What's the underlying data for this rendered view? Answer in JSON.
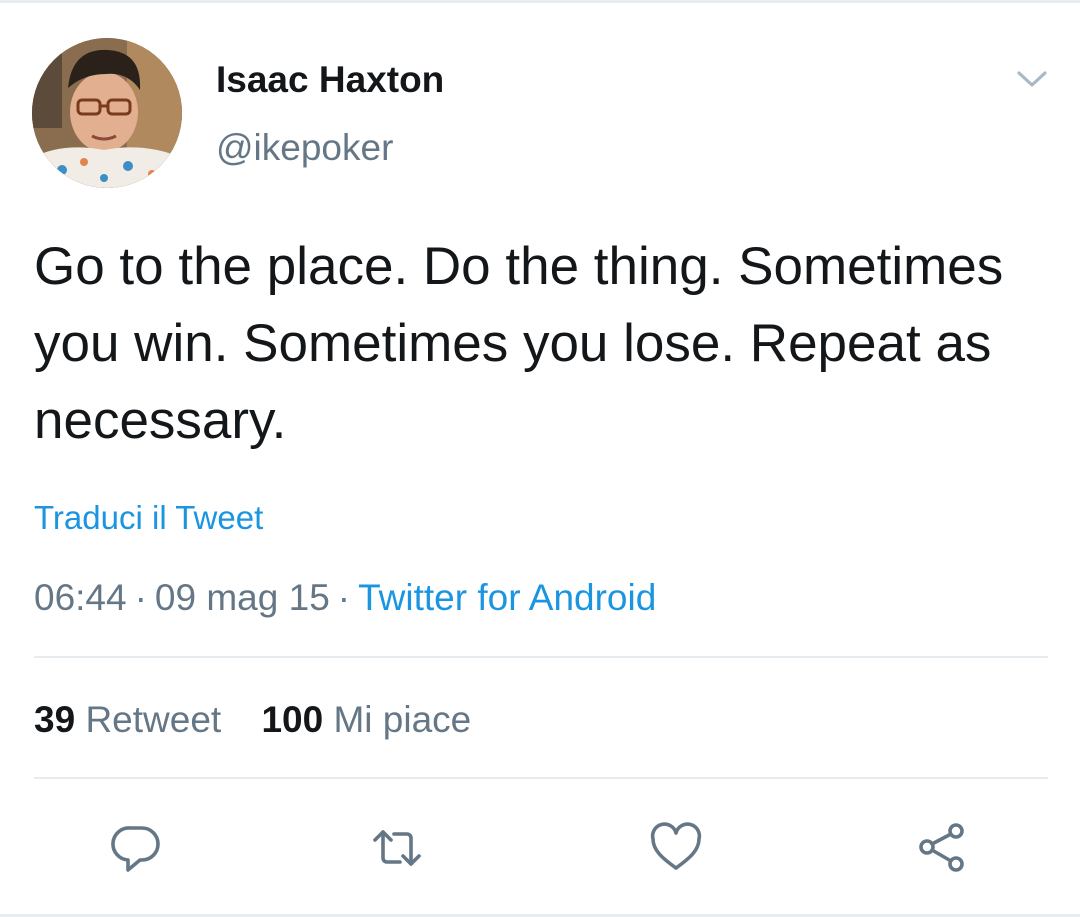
{
  "user": {
    "display_name": "Isaac Haxton",
    "handle": "@ikepoker"
  },
  "tweet": {
    "text": "Go to the place. Do the thing. Sometimes you win. Sometimes you lose. Repeat as necessary.",
    "translate_label": "Traduci il Tweet",
    "time": "06:44",
    "date": "09 mag 15",
    "separator": "·",
    "source": "Twitter for Android"
  },
  "stats": {
    "retweets_count": "39",
    "retweets_label": "Retweet",
    "likes_count": "100",
    "likes_label": "Mi piace"
  },
  "icons": {
    "menu": "chevron-down-icon",
    "reply": "reply-icon",
    "retweet": "retweet-icon",
    "like": "heart-icon",
    "share": "share-icon"
  },
  "colors": {
    "text_primary": "#14171a",
    "text_secondary": "#657786",
    "link": "#1b95e0",
    "divider": "#e6ecf0"
  }
}
